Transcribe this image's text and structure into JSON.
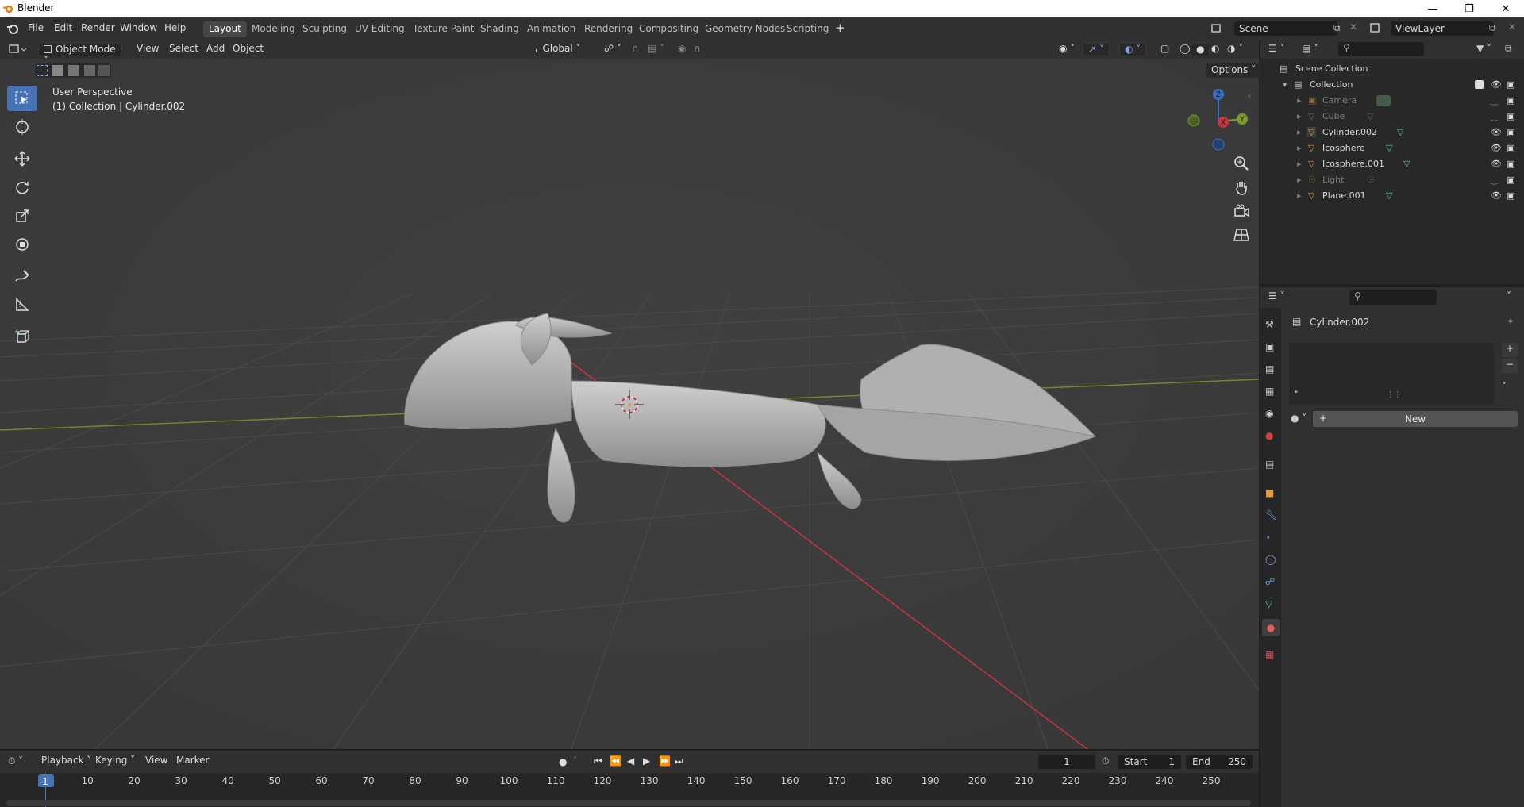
{
  "window": {
    "title": "Blender"
  },
  "menu": [
    "File",
    "Edit",
    "Render",
    "Window",
    "Help"
  ],
  "workspaces": [
    "Layout",
    "Modeling",
    "Sculpting",
    "UV Editing",
    "Texture Paint",
    "Shading",
    "Animation",
    "Rendering",
    "Compositing",
    "Geometry Nodes",
    "Scripting"
  ],
  "active_workspace": "Layout",
  "scene": {
    "name": "Scene",
    "view_layer": "ViewLayer"
  },
  "viewport": {
    "mode": "Object Mode",
    "menus": [
      "View",
      "Select",
      "Add",
      "Object"
    ],
    "transform_orientation": "Global",
    "options_label": "Options",
    "info_line1": "User Perspective",
    "info_line2": "(1) Collection | Cylinder.002",
    "gizmo": {
      "z": "Z",
      "y": "Y",
      "x": "X"
    }
  },
  "outliner": {
    "root": "Scene Collection",
    "collection": "Collection",
    "items": [
      {
        "name": "Camera",
        "hidden": true
      },
      {
        "name": "Cube",
        "hidden": true
      },
      {
        "name": "Cylinder.002",
        "hidden": false
      },
      {
        "name": "Icosphere",
        "hidden": false
      },
      {
        "name": "Icosphere.001",
        "hidden": false
      },
      {
        "name": "Light",
        "hidden": true
      },
      {
        "name": "Plane.001",
        "hidden": false
      }
    ]
  },
  "properties": {
    "object_name": "Cylinder.002",
    "new_button": "New"
  },
  "timeline": {
    "menus": [
      "Playback",
      "Keying",
      "View",
      "Marker"
    ],
    "current_frame": "1",
    "start_label": "Start",
    "start": "1",
    "end_label": "End",
    "end": "250",
    "ruler": [
      "1",
      "10",
      "20",
      "30",
      "40",
      "50",
      "60",
      "70",
      "80",
      "90",
      "100",
      "110",
      "120",
      "130",
      "140",
      "150",
      "160",
      "170",
      "180",
      "190",
      "200",
      "210",
      "220",
      "230",
      "240",
      "250"
    ]
  },
  "colors": {
    "accent": "#4772b3",
    "x_axis": "#c5343f",
    "y_axis": "#7a9a2c",
    "mesh": "#b9b9b9"
  }
}
